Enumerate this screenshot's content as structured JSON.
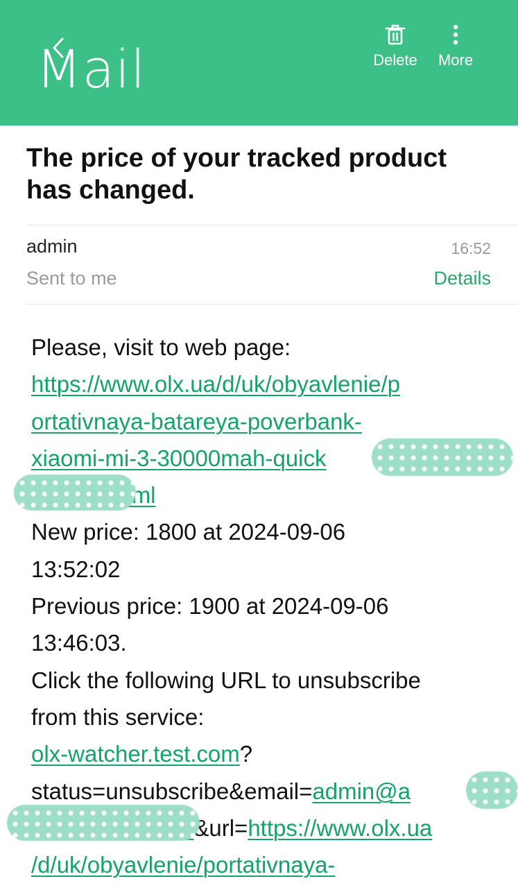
{
  "header": {
    "title": "Mail",
    "actions": [
      {
        "label": "Delete",
        "icon": "trash-icon"
      },
      {
        "label": "More",
        "icon": "more-vertical-icon"
      }
    ],
    "background_color": "#3dbf88"
  },
  "message": {
    "subject": "The price of your tracked product has changed.",
    "sender": "admin",
    "recipient": "Sent to me",
    "time": "16:52",
    "details_label": "Details",
    "body": {
      "intro": "Please, visit to web page:",
      "product_link_lines": [
        "https://www.olx.ua/d/uk/obyavlenie/p",
        "ortativnaya-batareya-poverbank-",
        "xiaomi-mi-3-30000mah-quick",
        ".html"
      ],
      "new_price_lines": [
        "New price: 1800 at 2024-09-06",
        "13:52:02"
      ],
      "previous_price_lines": [
        "Previous price: 1900 at 2024-09-06",
        "13:46:03."
      ],
      "unsubscribe_lines": [
        "Click the following URL to unsubscribe",
        "from this service:"
      ],
      "unsub_link": "olx-watcher.test.com",
      "unsub_suffix": "?",
      "status_text": "status=unsubscribe&email=",
      "email_link_part": "admin@a",
      "email_link_tail": "a",
      "url_param": "&url=",
      "url_link_part1": "https://www.olx.ua",
      "url_link_part2": "/d/uk/obyavlenie/portativnaya-"
    }
  },
  "colors": {
    "accent": "#3dbf88",
    "link": "#14a36a",
    "muted": "#9a9a9a"
  }
}
